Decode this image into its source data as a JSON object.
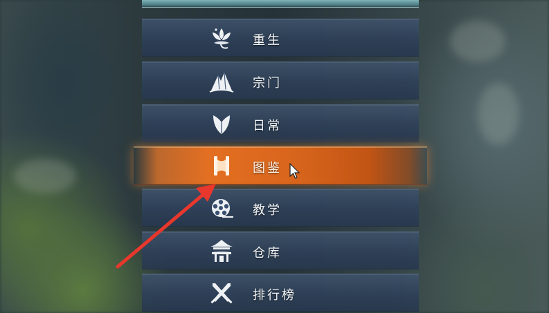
{
  "menu": {
    "items": [
      {
        "label": "重生",
        "icon": "lotus-flower-icon",
        "active": false
      },
      {
        "label": "宗门",
        "icon": "mountain-sect-icon",
        "active": false
      },
      {
        "label": "日常",
        "icon": "shield-bird-icon",
        "active": false
      },
      {
        "label": "图鉴",
        "icon": "scroll-handbook-icon",
        "active": true
      },
      {
        "label": "教学",
        "icon": "film-reel-icon",
        "active": false
      },
      {
        "label": "仓库",
        "icon": "pavilion-warehouse-icon",
        "active": false
      },
      {
        "label": "排行榜",
        "icon": "crossed-swords-icon",
        "active": false
      }
    ]
  },
  "colors": {
    "item_bg": "#2e4058",
    "active_bg": "#e36f22",
    "label_text": "#f2f4f6",
    "annotation_arrow": "#e8372c",
    "icon_fill": "#f2f4f6"
  },
  "annotation": {
    "type": "arrow",
    "points_to": "图鉴"
  }
}
